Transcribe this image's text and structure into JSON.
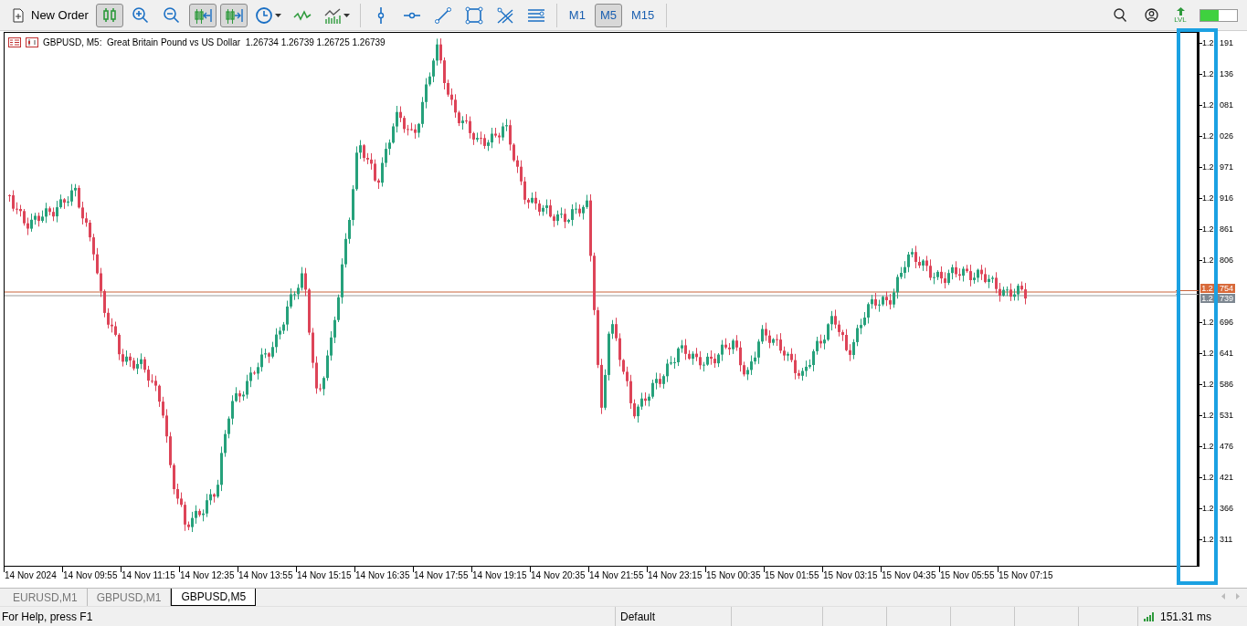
{
  "toolbar": {
    "new_order": "New Order",
    "tools": [
      {
        "kind": "candles",
        "selected": true
      },
      {
        "kind": "zoom-in",
        "selected": false
      },
      {
        "kind": "zoom-out",
        "selected": false
      },
      {
        "kind": "shift",
        "selected": true
      },
      {
        "kind": "autoscroll",
        "selected": true
      },
      {
        "kind": "clock",
        "selected": false
      },
      {
        "kind": "wave",
        "selected": false
      },
      {
        "kind": "indicators",
        "selected": false
      },
      {
        "kind": "vline",
        "selected": false
      },
      {
        "kind": "hline",
        "selected": false
      },
      {
        "kind": "trendline",
        "selected": false
      },
      {
        "kind": "rectangle",
        "selected": false
      },
      {
        "kind": "scissors",
        "selected": false
      },
      {
        "kind": "fibo",
        "selected": false
      }
    ],
    "timeframes": [
      {
        "label": "M1",
        "selected": false
      },
      {
        "label": "M5",
        "selected": true
      },
      {
        "label": "M15",
        "selected": false
      }
    ],
    "lvl_label": "LVL",
    "meter": {
      "level": 0.5
    }
  },
  "chart": {
    "header": "GBPUSD, M5:  Great Britain Pound vs US Dollar  1.26734 1.26739 1.26725 1.26739",
    "price_labels": [
      {
        "lead": "1.2",
        "tail": "191"
      },
      {
        "lead": "1.2",
        "tail": "136"
      },
      {
        "lead": "1.2",
        "tail": "081"
      },
      {
        "lead": "1.2",
        "tail": "026"
      },
      {
        "lead": "1.2",
        "tail": "971"
      },
      {
        "lead": "1.2",
        "tail": "916"
      },
      {
        "lead": "1.2",
        "tail": "861"
      },
      {
        "lead": "1.2",
        "tail": "806"
      },
      {
        "lead": "1.2",
        "tail": "696"
      },
      {
        "lead": "1.2",
        "tail": "641"
      },
      {
        "lead": "1.2",
        "tail": "586"
      },
      {
        "lead": "1.2",
        "tail": "531"
      },
      {
        "lead": "1.2",
        "tail": "476"
      },
      {
        "lead": "1.2",
        "tail": "421"
      },
      {
        "lead": "1.2",
        "tail": "366"
      },
      {
        "lead": "1.2",
        "tail": "311"
      }
    ],
    "ask_tag": {
      "lead": "1.2",
      "tail": "754"
    },
    "bid_tag": {
      "lead": "1.2",
      "tail": "739"
    },
    "time_labels": [
      "14 Nov 2024",
      "14 Nov 09:55",
      "14 Nov 11:15",
      "14 Nov 12:35",
      "14 Nov 13:55",
      "14 Nov 15:15",
      "14 Nov 16:35",
      "14 Nov 17:55",
      "14 Nov 19:15",
      "14 Nov 20:35",
      "14 Nov 21:55",
      "14 Nov 23:15",
      "15 Nov 00:35",
      "15 Nov 01:55",
      "15 Nov 03:15",
      "15 Nov 04:35",
      "15 Nov 05:55",
      "15 Nov 07:15"
    ]
  },
  "tabs": [
    {
      "label": "EURUSD,M1",
      "selected": false
    },
    {
      "label": "GBPUSD,M1",
      "selected": false
    },
    {
      "label": "GBPUSD,M5",
      "selected": true
    }
  ],
  "status_bar": {
    "help": "For Help, press F1",
    "profile": "Default",
    "ping": "151.31 ms"
  }
}
